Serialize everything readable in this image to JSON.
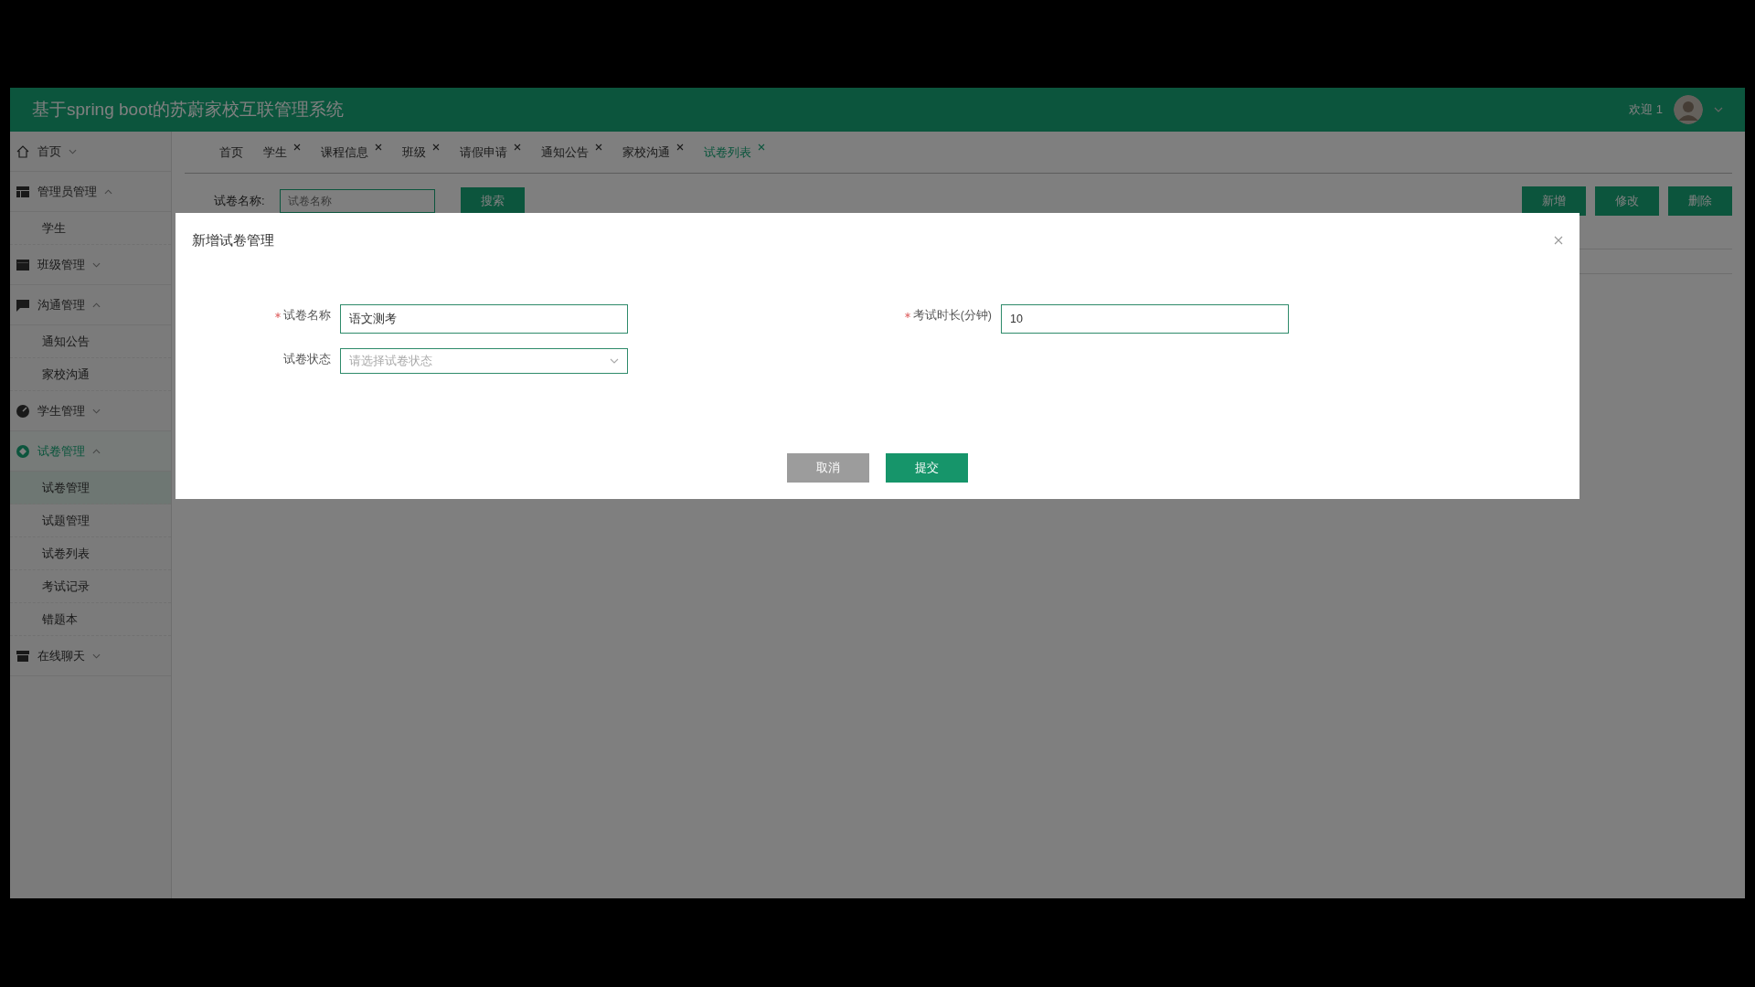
{
  "header": {
    "title": "基于spring boot的苏蔚家校互联管理系统",
    "greeting": "欢迎 1"
  },
  "sidebar": {
    "items": [
      {
        "kind": "group",
        "label": "首页",
        "expanded": false,
        "selected": false
      },
      {
        "kind": "group",
        "label": "管理员管理",
        "expanded": true,
        "selected": false,
        "children": [
          {
            "label": "学生",
            "selected": false
          }
        ]
      },
      {
        "kind": "group",
        "label": "班级管理",
        "expanded": false,
        "selected": false
      },
      {
        "kind": "group",
        "label": "沟通管理",
        "expanded": true,
        "selected": false,
        "children": [
          {
            "label": "通知公告",
            "selected": false
          },
          {
            "label": "家校沟通",
            "selected": false
          }
        ]
      },
      {
        "kind": "group",
        "label": "学生管理",
        "expanded": false,
        "selected": false
      },
      {
        "kind": "group",
        "label": "试卷管理",
        "expanded": true,
        "selected": true,
        "children": [
          {
            "label": "试卷管理",
            "selected": true
          },
          {
            "label": "试题管理",
            "selected": false
          },
          {
            "label": "试卷列表",
            "selected": false
          },
          {
            "label": "考试记录",
            "selected": false
          },
          {
            "label": "错题本",
            "selected": false
          }
        ]
      },
      {
        "kind": "group",
        "label": "在线聊天",
        "expanded": false,
        "selected": false
      }
    ]
  },
  "tabs": [
    {
      "label": "首页",
      "closable": false,
      "selected": false
    },
    {
      "label": "学生",
      "closable": true,
      "selected": false
    },
    {
      "label": "课程信息",
      "closable": true,
      "selected": false
    },
    {
      "label": "班级",
      "closable": true,
      "selected": false
    },
    {
      "label": "请假申请",
      "closable": true,
      "selected": false
    },
    {
      "label": "通知公告",
      "closable": true,
      "selected": false
    },
    {
      "label": "家校沟通",
      "closable": true,
      "selected": false
    },
    {
      "label": "试卷列表",
      "closable": true,
      "selected": true
    }
  ],
  "search": {
    "label": "试卷名称:",
    "placeholder": "试卷名称",
    "button": "搜索"
  },
  "actions": [
    "新增",
    "修改",
    "删除"
  ],
  "dialog": {
    "title": "新增试卷管理",
    "rows": [
      [
        {
          "kind": "input",
          "label": "试卷名称",
          "required": true,
          "value": "语文测考"
        },
        {
          "kind": "input",
          "label": "考试时长(分钟)",
          "required": true,
          "value": "10"
        }
      ],
      [
        {
          "kind": "select",
          "label": "试卷状态",
          "required": false,
          "placeholder": "请选择试卷状态"
        }
      ]
    ],
    "buttons": [
      {
        "label": "取消",
        "kind": "cancel"
      },
      {
        "label": "提交",
        "kind": "primary"
      }
    ]
  }
}
